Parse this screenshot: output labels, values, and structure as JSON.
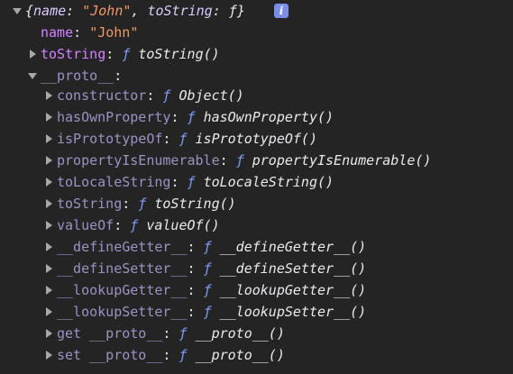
{
  "summary": {
    "open_brace": "{",
    "key_name": "name",
    "colon": ": ",
    "name_value": "\"John\"",
    "comma": ", ",
    "key_tostring": "toString",
    "f_symbol": "ƒ",
    "close_brace": "}",
    "info_glyph": "i"
  },
  "props": {
    "name_key": "name",
    "name_value": "\"John\"",
    "tostring_key": "toString",
    "tostring_value": "toString()",
    "proto_key": "__proto__",
    "proto_colon": ":"
  },
  "f_symbol": "ƒ",
  "colon": ":",
  "proto_members": [
    {
      "key": "constructor",
      "value": "Object()"
    },
    {
      "key": "hasOwnProperty",
      "value": "hasOwnProperty()"
    },
    {
      "key": "isPrototypeOf",
      "value": "isPrototypeOf()"
    },
    {
      "key": "propertyIsEnumerable",
      "value": "propertyIsEnumerable()"
    },
    {
      "key": "toLocaleString",
      "value": "toLocaleString()"
    },
    {
      "key": "toString",
      "value": "toString()"
    },
    {
      "key": "valueOf",
      "value": "valueOf()"
    },
    {
      "key": "__defineGetter__",
      "value": "__defineGetter__()"
    },
    {
      "key": "__defineSetter__",
      "value": "__defineSetter__()"
    },
    {
      "key": "__lookupGetter__",
      "value": "__lookupGetter__()"
    },
    {
      "key": "__lookupSetter__",
      "value": "__lookupSetter__()"
    },
    {
      "key": "get __proto__",
      "value": "__proto__()"
    },
    {
      "key": "set __proto__",
      "value": "__proto__()"
    }
  ],
  "colors": {
    "background": "#242424",
    "key_own": "#d281ff",
    "key_inherited": "#9e91c4",
    "string": "#f29766",
    "function_symbol": "#7b9cf5",
    "info_badge": "#7b8ee8"
  },
  "icons": {
    "expanded": "triangle-down-icon",
    "collapsed": "triangle-right-icon",
    "info": "info-icon"
  }
}
